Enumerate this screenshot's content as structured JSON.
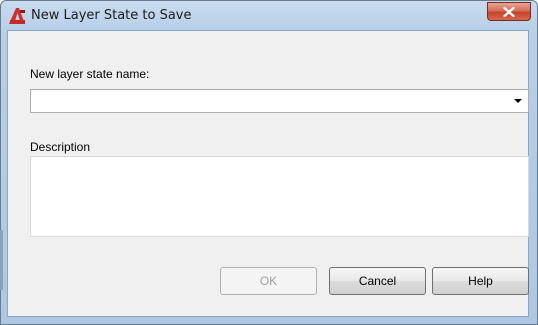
{
  "window": {
    "title": "New Layer State to Save",
    "close_label": "x"
  },
  "form": {
    "name_label": "New layer state name:",
    "name_value": "",
    "description_label": "Description",
    "description_value": ""
  },
  "buttons": {
    "ok": "OK",
    "cancel": "Cancel",
    "help": "Help"
  },
  "colors": {
    "app_icon": "#d32f2f",
    "close_button": "#c4462c"
  }
}
